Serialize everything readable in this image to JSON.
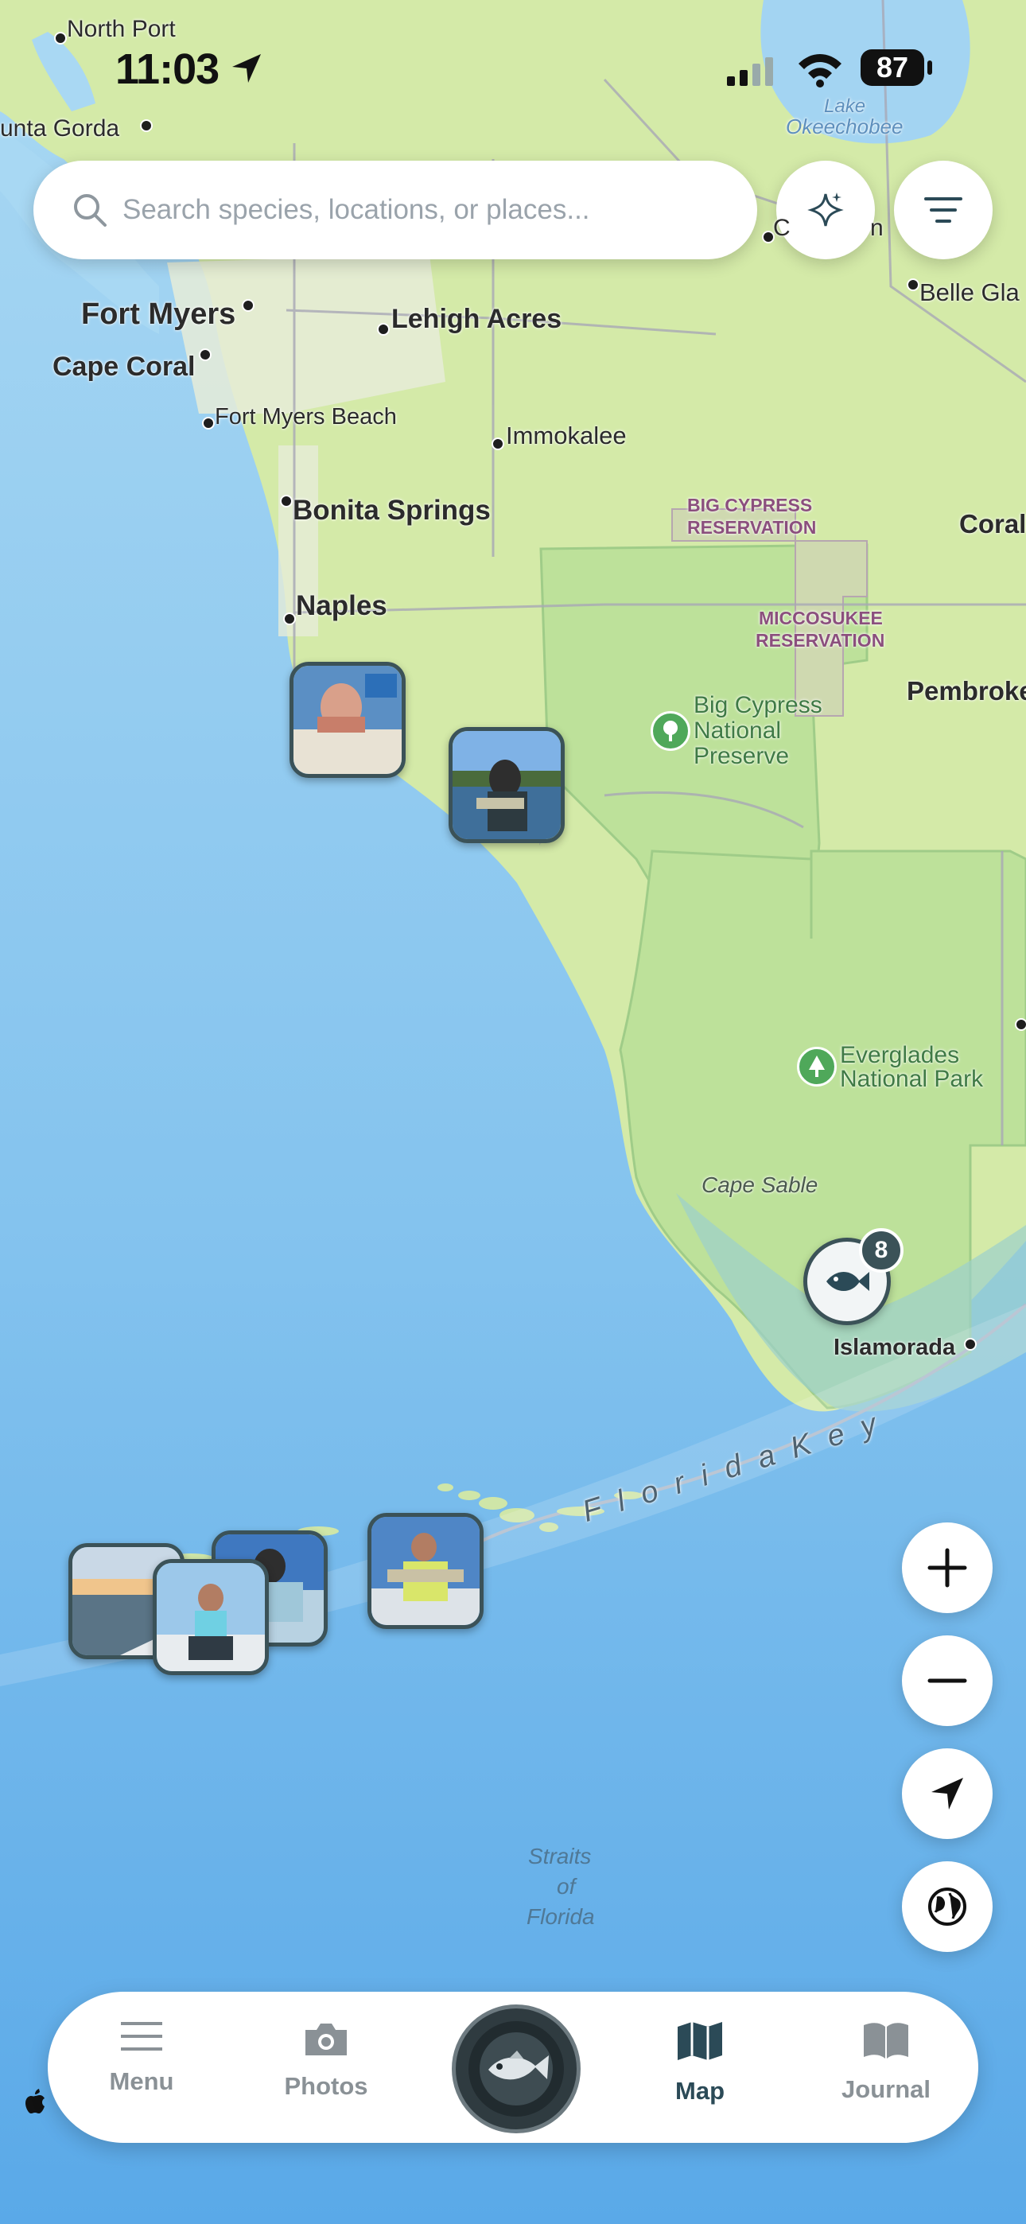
{
  "status_bar": {
    "time": "11:03",
    "battery": "87"
  },
  "search": {
    "placeholder": "Search species, locations, or places..."
  },
  "top_buttons": {
    "ai": "sparkle-icon",
    "filter": "filter-icon"
  },
  "map": {
    "places": {
      "north_port": "North Port",
      "punta_gorda": "unta Gorda",
      "fort_myers": "Fort Myers",
      "cape_coral": "Cape Coral",
      "lehigh_acres": "Lehigh Acres",
      "fort_myers_beach": "Fort Myers Beach",
      "immokalee": "Immokalee",
      "bonita_springs": "Bonita Springs",
      "naples": "Naples",
      "belle_glade": "Belle Gla",
      "clewiston": "C",
      "clewiston_end": "n",
      "coral": "Coral",
      "pembroke": "Pembroke",
      "islamorada": "Islamorada",
      "lake_okeechobee_1": "Lake",
      "lake_okeechobee_2": "Okeechobee",
      "big_cypress_res_1": "BIG CYPRESS",
      "big_cypress_res_2": "RESERVATION",
      "miccosukee_1": "MICCOSUKEE",
      "miccosukee_2": "RESERVATION",
      "big_cypress_pres_1": "Big Cypress",
      "big_cypress_pres_2": "National",
      "big_cypress_pres_3": "Preserve",
      "everglades_1": "Everglades",
      "everglades_2": "National Park",
      "cape_sable": "Cape Sable",
      "florida_keys": "F l o r i d a   K e y",
      "straits_1": "Straits",
      "straits_2": "of",
      "straits_3": "Florida"
    },
    "cluster_count": "8"
  },
  "map_controls": {
    "zoom_in": "plus-icon",
    "zoom_out": "minus-icon",
    "locate": "location-arrow-icon",
    "globe": "globe-icon"
  },
  "tabs": {
    "menu": "Menu",
    "photos": "Photos",
    "map": "Map",
    "journal": "Journal"
  },
  "colors": {
    "accent": "#2b4a57",
    "water": "#8ec9ef",
    "land": "#d6ebb0",
    "park": "#bfe3a0"
  }
}
